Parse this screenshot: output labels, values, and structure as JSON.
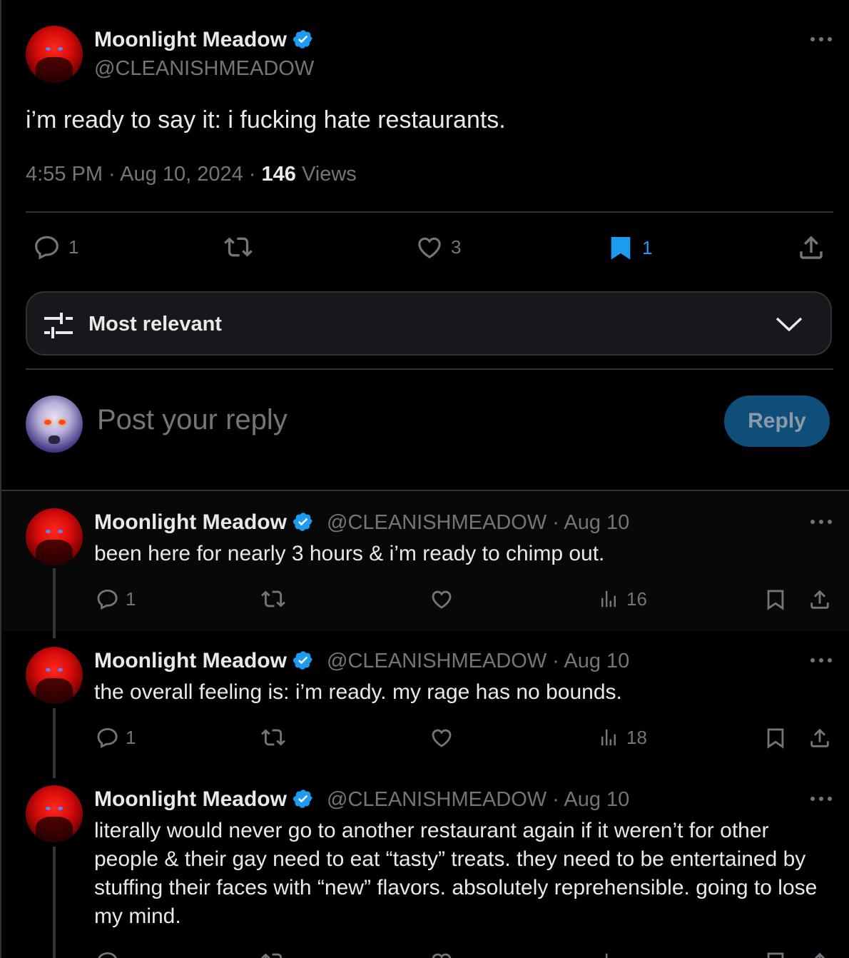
{
  "main_tweet": {
    "author_name": "Moonlight Meadow",
    "author_handle": "@CLEANISHMEADOW",
    "text": "i’m ready to say it: i fucking hate restaurants.",
    "time": "4:55 PM",
    "date": "Aug 10, 2024",
    "views_count": "146",
    "views_label": "Views",
    "actions": {
      "replies": "1",
      "retweets": "",
      "likes": "3",
      "bookmarks": "1"
    }
  },
  "sort": {
    "label": "Most relevant"
  },
  "composer": {
    "placeholder": "Post your reply",
    "reply_button": "Reply"
  },
  "replies": [
    {
      "author_name": "Moonlight Meadow",
      "handle_date": "@CLEANISHMEADOW · Aug 10",
      "text": "been here for nearly 3 hours & i’m ready to chimp out.",
      "replies": "1",
      "views": "16"
    },
    {
      "author_name": "Moonlight Meadow",
      "handle_date": "@CLEANISHMEADOW · Aug 10",
      "text": "the overall feeling is: i’m ready. my rage has no bounds.",
      "replies": "1",
      "views": "18"
    },
    {
      "author_name": "Moonlight Meadow",
      "handle_date": "@CLEANISHMEADOW · Aug 10",
      "text": "literally would never go to another restaurant again if it weren’t for other people & their gay need to eat “tasty” treats. they need to be entertained by stuffing their faces with “new” flavors. absolutely reprehensible. going to lose my mind."
    }
  ],
  "colors": {
    "background": "#000000",
    "text": "#e7e9ea",
    "muted": "#71767b",
    "accent": "#1d9bf0",
    "border": "#2f3336",
    "reply_button_bg": "#0f4e78"
  },
  "icons": [
    "verified-badge-icon",
    "more-icon",
    "reply-icon",
    "retweet-icon",
    "like-icon",
    "bookmark-icon",
    "share-icon",
    "sliders-icon",
    "chevron-down-icon",
    "views-icon"
  ]
}
